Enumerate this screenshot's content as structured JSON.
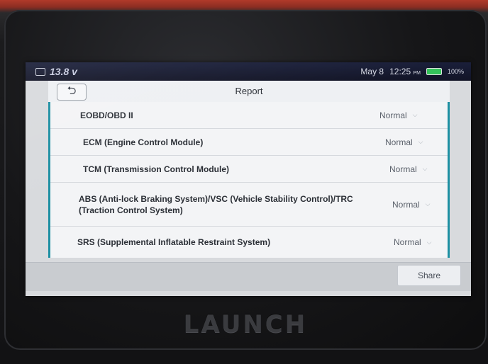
{
  "status_bar": {
    "voltage": "13.8 v",
    "date": "May 8",
    "time": "12:25",
    "ampm": "PM",
    "battery": "100%"
  },
  "app_bar": {
    "back_label": "⮌",
    "title": "Report"
  },
  "modules": [
    {
      "name": "EOBD/OBD II",
      "status": "Normal"
    },
    {
      "name": "ECM (Engine Control Module)",
      "status": "Normal"
    },
    {
      "name": "TCM (Transmission Control Module)",
      "status": "Normal"
    },
    {
      "name": "ABS (Anti-lock Braking System)/VSC (Vehicle Stability Control)/TRC (Traction Control System)",
      "status": "Normal"
    },
    {
      "name": "SRS (Supplemental Inflatable Restraint System)",
      "status": "Normal"
    }
  ],
  "footer": {
    "share_label": "Share"
  },
  "device": {
    "brand": "LAUNCH"
  },
  "icons": {
    "dropdown": "chevron-down-icon",
    "back": "back-arrow-icon",
    "car": "car-icon",
    "battery": "battery-icon"
  },
  "colors": {
    "accent": "#1d8fa2",
    "battery": "#34c35a",
    "status_bar": "#1a1f3a"
  }
}
